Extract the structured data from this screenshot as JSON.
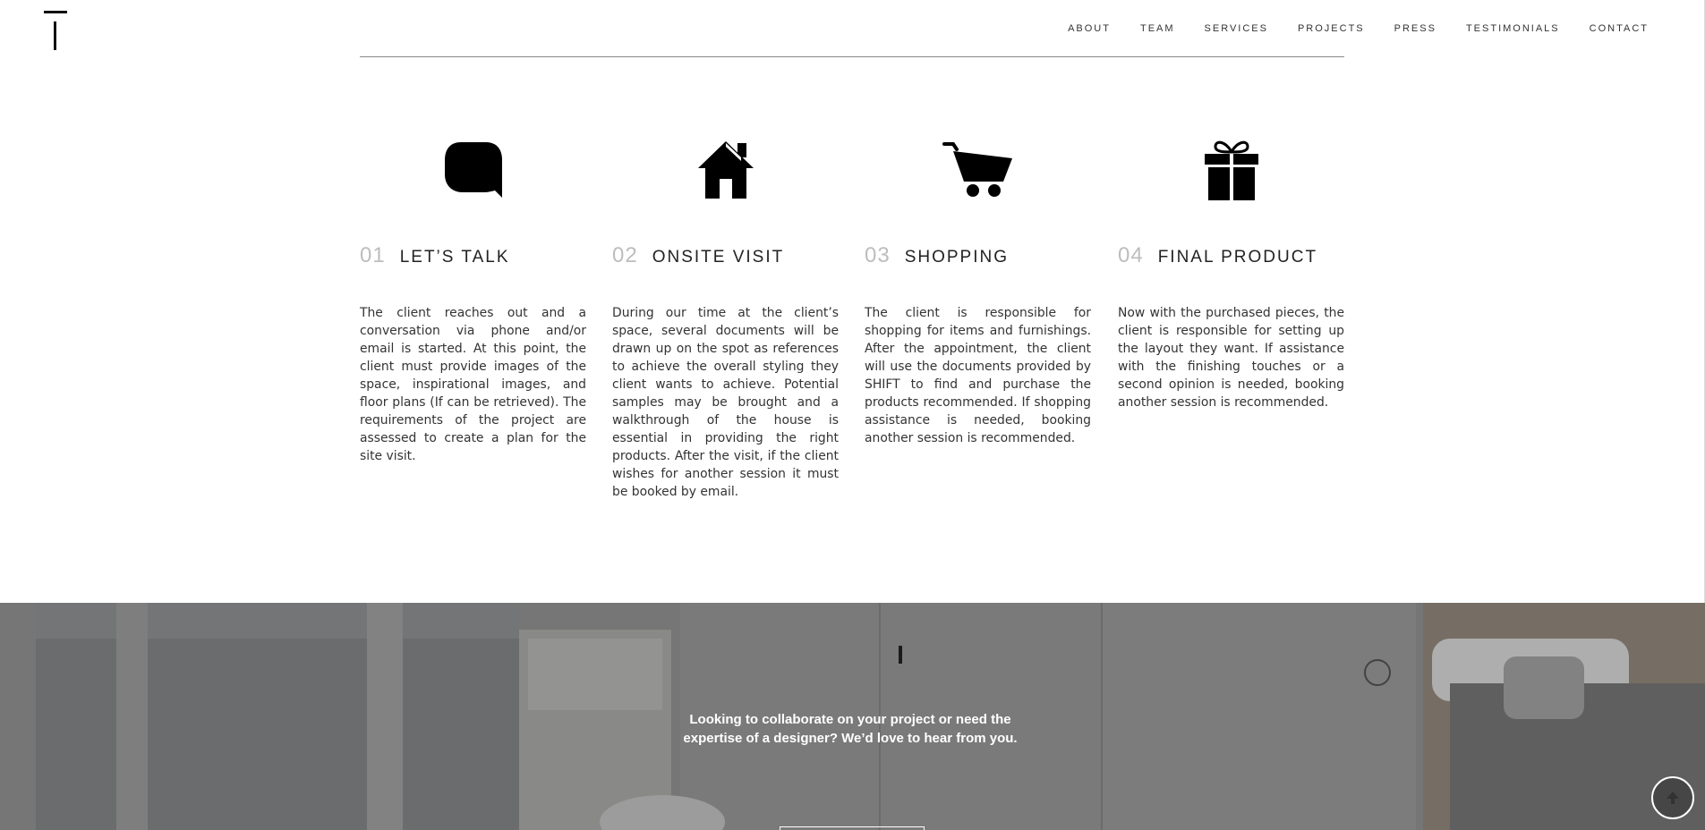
{
  "header": {
    "logo_alt": "",
    "nav": [
      "ABOUT",
      "TEAM",
      "SERVICES",
      "PROJECTS",
      "PRESS",
      "TESTIMONIALS",
      "CONTACT"
    ]
  },
  "steps": [
    {
      "number": "01",
      "title": "LET’S TALK",
      "icon": "speech-bubble-icon",
      "description": "The client reaches out and a conversation via phone and/or email is started. At this point, the client must provide images of the space, inspirational images, and floor plans (If can be retrieved). The requirements of the project are assessed to create a plan for the site visit."
    },
    {
      "number": "02",
      "title": "ONSITE VISIT",
      "icon": "house-icon",
      "description": "During our time at the client’s space, several documents will be drawn up on the spot as references to achieve the overall styling they client wants to achieve.  Potential samples may be brought and a walkthrough of the house is essential in providing the right products. After the visit, if the client wishes for another session it must be booked by email."
    },
    {
      "number": "03",
      "title": "SHOPPING",
      "icon": "shopping-cart-icon",
      "description": "The client is responsible for shopping for items and furnishings. After the appointment, the client will use the documents provided by SHIFT to find and purchase the products recommended.  If shopping assistance is needed, booking another session is recommended."
    },
    {
      "number": "04",
      "title": "FINAL PRODUCT",
      "icon": "gift-icon",
      "description": "Now with the purchased pieces, the client is responsible for setting up the layout they want. If assistance with the finishing touches or a second opinion is needed, booking another session is recommended."
    }
  ],
  "banner": {
    "text": "Looking to collaborate on your project or need the expertise of a designer? We’d love to hear from you.",
    "button_label": ""
  },
  "colors": {
    "number_grey": "#bdbdbd",
    "text": "#333333",
    "banner_overlay": "#6f6f6f"
  }
}
